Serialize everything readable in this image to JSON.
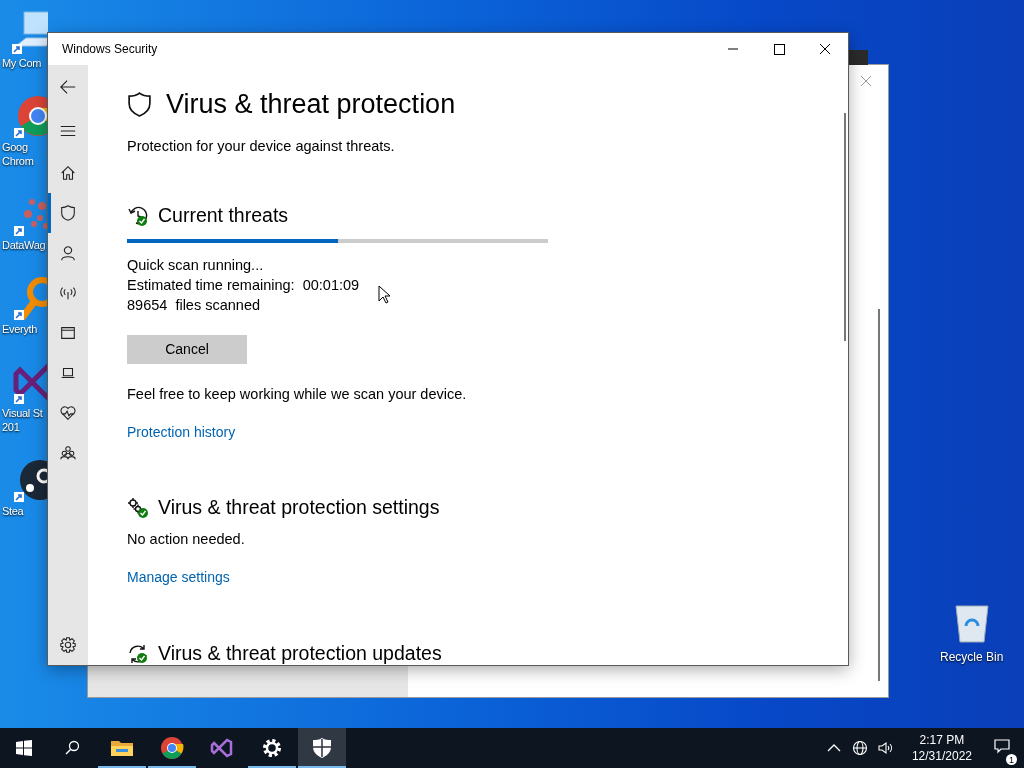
{
  "desktop_icons": [
    {
      "kind": "computer",
      "lines": [
        "My Com"
      ]
    },
    {
      "kind": "chrome",
      "lines": [
        "Goog",
        "Chrom"
      ]
    },
    {
      "kind": "datawag",
      "lines": [
        "DataWag"
      ]
    },
    {
      "kind": "everything",
      "lines": [
        "Everyth"
      ]
    },
    {
      "kind": "visualstudio",
      "lines": [
        "Visual St",
        "201"
      ]
    },
    {
      "kind": "steam",
      "lines": [
        "Stea"
      ]
    }
  ],
  "recycle_bin": {
    "label": "Recycle Bin"
  },
  "window": {
    "title": "Windows Security"
  },
  "nav": [
    {
      "kind": "back",
      "selected": false
    },
    {
      "kind": "menu",
      "selected": false
    },
    {
      "kind": "home",
      "selected": false
    },
    {
      "kind": "shield",
      "selected": true
    },
    {
      "kind": "account",
      "selected": false
    },
    {
      "kind": "network",
      "selected": false
    },
    {
      "kind": "browser",
      "selected": false
    },
    {
      "kind": "device",
      "selected": false
    },
    {
      "kind": "health",
      "selected": false
    },
    {
      "kind": "family",
      "selected": false
    },
    {
      "kind": "settings",
      "selected": false
    }
  ],
  "page": {
    "title": "Virus & threat protection",
    "subtitle": "Protection for your device against threats."
  },
  "current_threats": {
    "heading": "Current threats",
    "progress": {
      "level": 0.5
    },
    "status_lines": [
      "Quick scan running...",
      "Estimated time remaining:  00:01:09",
      "89654  files scanned"
    ],
    "cancel_button": "Cancel",
    "note": "Feel free to keep working while we scan your device.",
    "link": "Protection history"
  },
  "settings_section": {
    "heading": "Virus & threat protection settings",
    "status": "No action needed.",
    "link": "Manage settings"
  },
  "updates_section": {
    "heading": "Virus & threat protection updates"
  },
  "taskbar": {
    "apps": [
      {
        "kind": "explorer",
        "running": true,
        "active": false
      },
      {
        "kind": "chrome",
        "running": true,
        "active": false
      },
      {
        "kind": "visualstudio",
        "running": false,
        "active": false
      },
      {
        "kind": "settings",
        "running": true,
        "active": false
      },
      {
        "kind": "security",
        "running": true,
        "active": true
      }
    ],
    "clock": {
      "time": "2:17 PM",
      "date": "12/31/2022"
    },
    "notifications": {
      "count": "1"
    }
  }
}
